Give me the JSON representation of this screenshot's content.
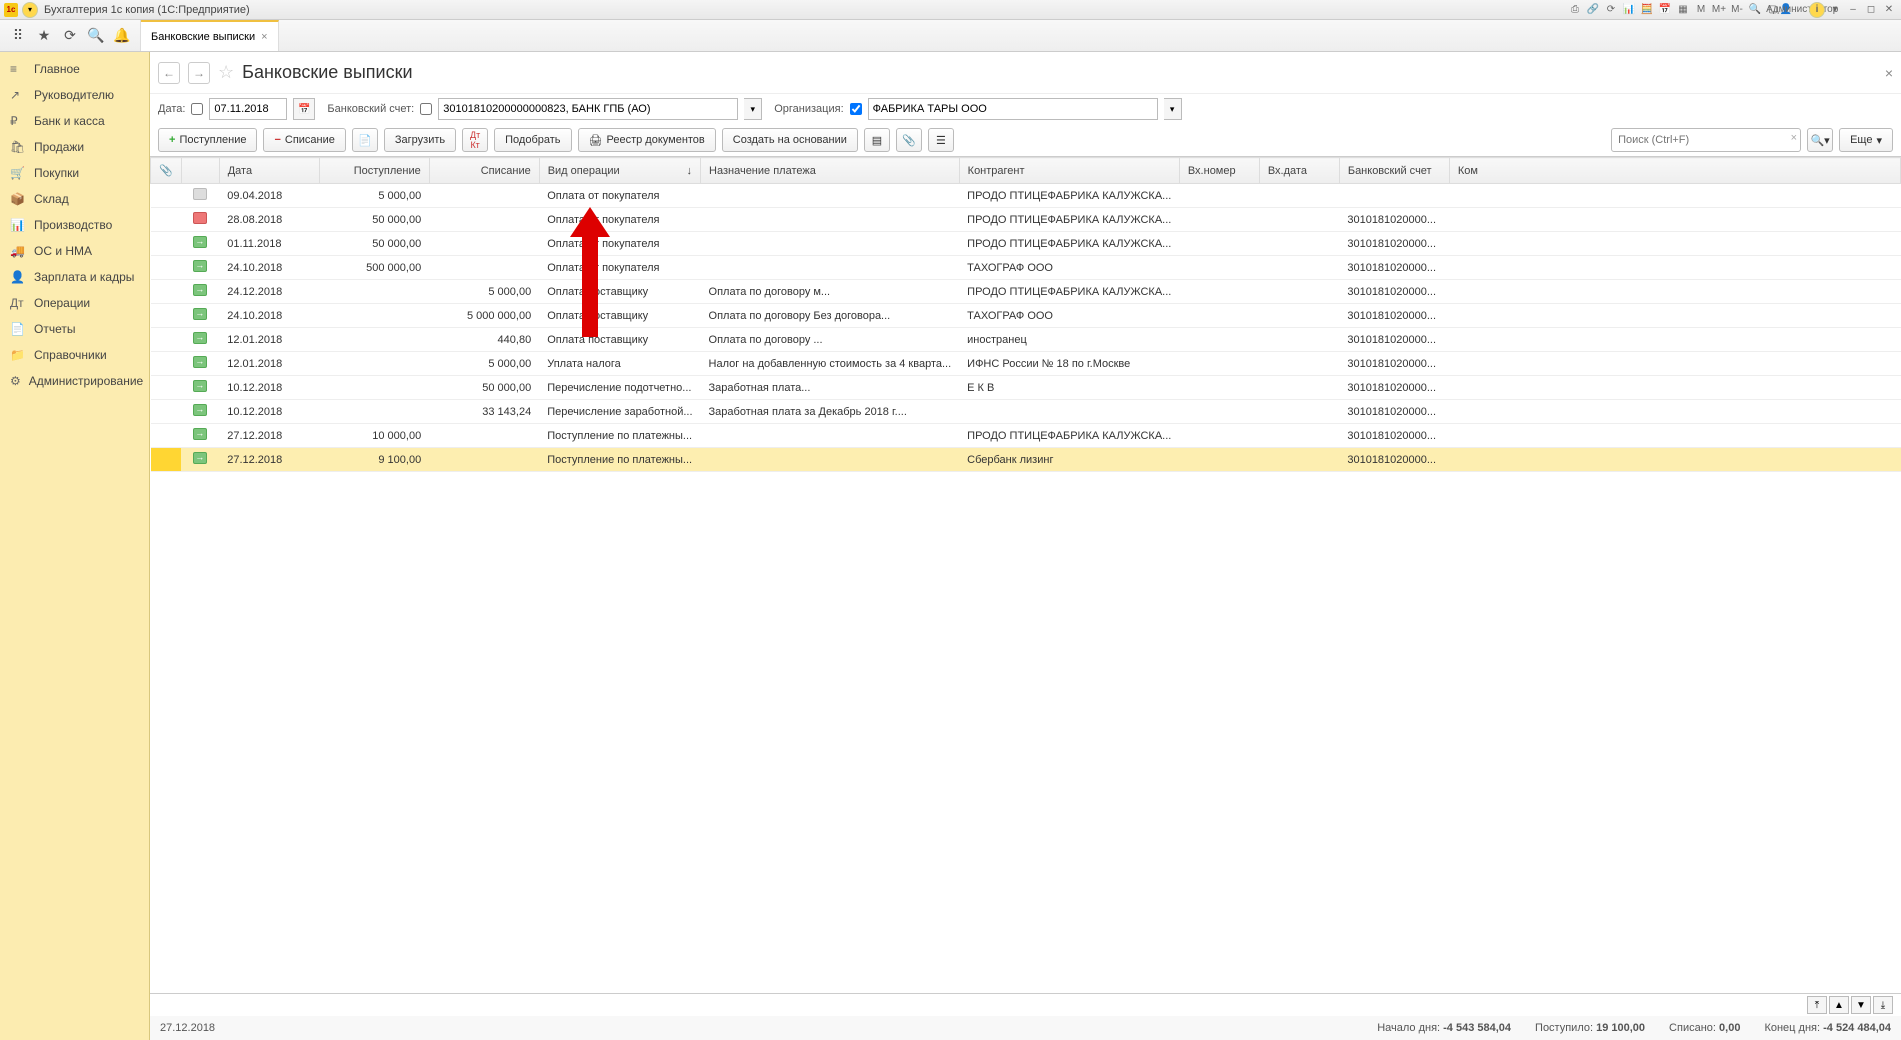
{
  "titlebar": {
    "app_title": "Бухгалтерия 1с копия  (1С:Предприятие)",
    "user_label": "Администратор",
    "m_buttons": [
      "M",
      "M+",
      "M-"
    ]
  },
  "quick_icons": {
    "grid": "⠿",
    "star": "★",
    "history": "⟳",
    "search": "🔍",
    "bell": "🔔"
  },
  "tabs": [
    {
      "label": "Банковские выписки"
    }
  ],
  "sidebar": {
    "items": [
      {
        "icon": "≡",
        "label": "Главное"
      },
      {
        "icon": "↗",
        "label": "Руководителю"
      },
      {
        "icon": "₽",
        "label": "Банк и касса"
      },
      {
        "icon": "🛍",
        "label": "Продажи"
      },
      {
        "icon": "🛒",
        "label": "Покупки"
      },
      {
        "icon": "📦",
        "label": "Склад"
      },
      {
        "icon": "📊",
        "label": "Производство"
      },
      {
        "icon": "🚚",
        "label": "ОС и НМА"
      },
      {
        "icon": "👤",
        "label": "Зарплата и кадры"
      },
      {
        "icon": "Дт",
        "label": "Операции"
      },
      {
        "icon": "📄",
        "label": "Отчеты"
      },
      {
        "icon": "📁",
        "label": "Справочники"
      },
      {
        "icon": "⚙",
        "label": "Администрирование"
      }
    ]
  },
  "page": {
    "title": "Банковские выписки",
    "filters": {
      "date_label": "Дата:",
      "date_value": "07.11.2018",
      "account_label": "Банковский счет:",
      "account_value": "30101810200000000823, БАНК ГПБ (АО)",
      "org_label": "Организация:",
      "org_value": "ФАБРИКА ТАРЫ ООО",
      "org_checked": true
    },
    "toolbar": {
      "income": "Поступление",
      "expense": "Списание",
      "load": "Загрузить",
      "select": "Подобрать",
      "registry": "Реестр документов",
      "create_based": "Создать на основании",
      "more": "Еще",
      "search_placeholder": "Поиск (Ctrl+F)"
    },
    "columns": {
      "attach": "",
      "status": "",
      "date": "Дата",
      "income": "Поступление",
      "expense": "Списание",
      "op": "Вид операции",
      "purpose": "Назначение платежа",
      "cp": "Контрагент",
      "innum": "Вх.номер",
      "indate": "Вх.дата",
      "bank": "Банковский счет",
      "comment": "Ком"
    },
    "rows": [
      {
        "st": "gray",
        "date": "09.04.2018",
        "in": "5 000,00",
        "out": "",
        "op": "Оплата от покупателя",
        "purpose": "",
        "cp": "ПРОДО ПТИЦЕФАБРИКА КАЛУЖСКА...",
        "bank": ""
      },
      {
        "st": "red",
        "date": "28.08.2018",
        "in": "50 000,00",
        "out": "",
        "op": "Оплата от покупателя",
        "purpose": "",
        "cp": "ПРОДО ПТИЦЕФАБРИКА КАЛУЖСКА...",
        "bank": "3010181020000..."
      },
      {
        "st": "green",
        "date": "01.11.2018",
        "in": "50 000,00",
        "out": "",
        "op": "Оплата от покупателя",
        "purpose": "",
        "cp": "ПРОДО ПТИЦЕФАБРИКА КАЛУЖСКА...",
        "bank": "3010181020000..."
      },
      {
        "st": "green",
        "date": "24.10.2018",
        "in": "500 000,00",
        "out": "",
        "op": "Оплата от покупателя",
        "purpose": "",
        "cp": "ТАХОГРАФ ООО",
        "bank": "3010181020000..."
      },
      {
        "st": "green",
        "date": "24.12.2018",
        "in": "",
        "out": "5 000,00",
        "op": "Оплата поставщику",
        "purpose": "Оплата по договору м...",
        "cp": "ПРОДО ПТИЦЕФАБРИКА КАЛУЖСКА...",
        "bank": "3010181020000..."
      },
      {
        "st": "green",
        "date": "24.10.2018",
        "in": "",
        "out": "5 000 000,00",
        "op": "Оплата поставщику",
        "purpose": "Оплата по договору Без договора...",
        "cp": "ТАХОГРАФ ООО",
        "bank": "3010181020000..."
      },
      {
        "st": "green",
        "date": "12.01.2018",
        "in": "",
        "out": "440,80",
        "op": "Оплата поставщику",
        "purpose": "Оплата по договору ...",
        "cp": "иностранец",
        "bank": "3010181020000..."
      },
      {
        "st": "green",
        "date": "12.01.2018",
        "in": "",
        "out": "5 000,00",
        "op": "Уплата налога",
        "purpose": "Налог на добавленную стоимость за 4 кварта...",
        "cp": "ИФНС России № 18 по г.Москве",
        "bank": "3010181020000..."
      },
      {
        "st": "green",
        "date": "10.12.2018",
        "in": "",
        "out": "50 000,00",
        "op": "Перечисление подотчетно...",
        "purpose": "Заработная плата...",
        "cp": "Е К В",
        "bank": "3010181020000..."
      },
      {
        "st": "green",
        "date": "10.12.2018",
        "in": "",
        "out": "33 143,24",
        "op": "Перечисление заработной...",
        "purpose": "Заработная плата за Декабрь 2018 г....",
        "cp": "",
        "bank": "3010181020000..."
      },
      {
        "st": "green",
        "date": "27.12.2018",
        "in": "10 000,00",
        "out": "",
        "op": "Поступление по платежны...",
        "purpose": "",
        "cp": "ПРОДО ПТИЦЕФАБРИКА КАЛУЖСКА...",
        "bank": "3010181020000..."
      },
      {
        "st": "green",
        "date": "27.12.2018",
        "in": "9 100,00",
        "out": "",
        "op": "Поступление по платежны...",
        "purpose": "",
        "cp": "Сбербанк лизинг",
        "bank": "3010181020000...",
        "selected": true
      }
    ],
    "status": {
      "date": "27.12.2018",
      "start_label": "Начало дня:",
      "start_val": "-4 543 584,04",
      "in_label": "Поступило:",
      "in_val": "19 100,00",
      "out_label": "Списано:",
      "out_val": "0,00",
      "end_label": "Конец дня:",
      "end_val": "-4 524 484,04"
    }
  }
}
